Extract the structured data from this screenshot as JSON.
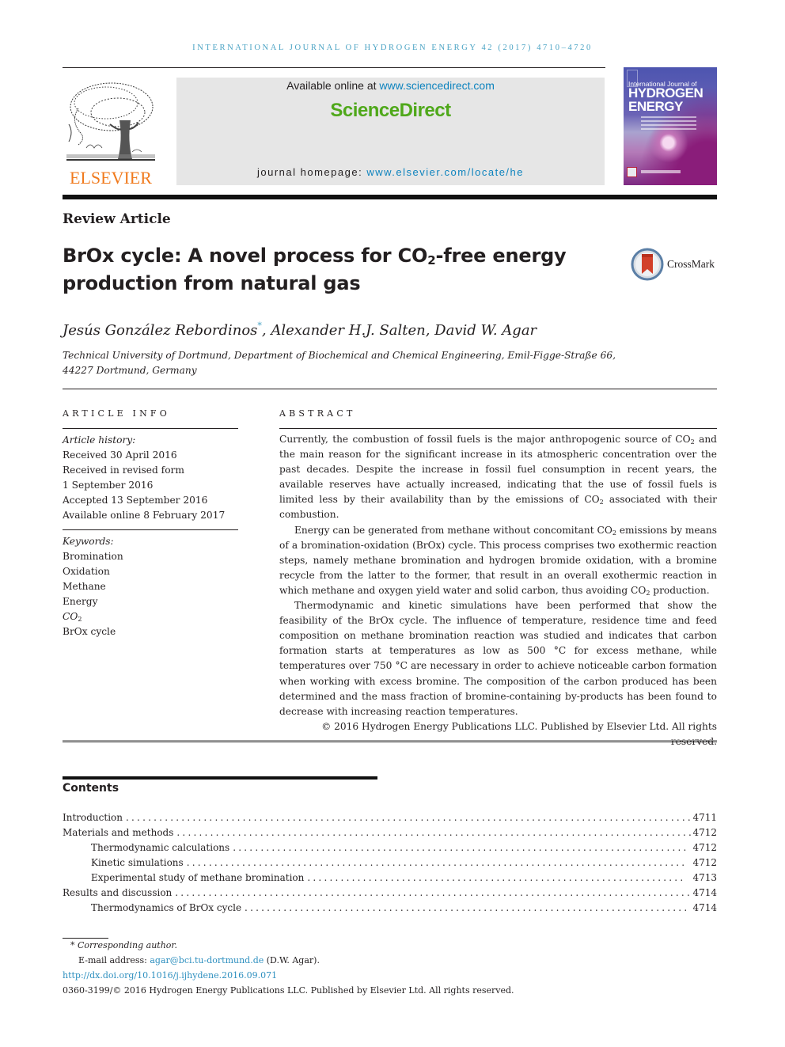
{
  "running_head": "INTERNATIONAL JOURNAL OF HYDROGEN ENERGY 42 (2017) 4710–4720",
  "publisher": {
    "logo_text": "ELSEVIER",
    "available_prefix": "Available online at ",
    "available_link": "www.sciencedirect.com",
    "brand": "ScienceDirect",
    "homepage_prefix": "journal homepage: ",
    "homepage_link": "www.elsevier.com/locate/he"
  },
  "cover": {
    "line1": "International Journal of",
    "line2": "HYDROGEN",
    "line3": "ENERGY"
  },
  "article_type": "Review Article",
  "title": {
    "part1": "BrOx cycle: A novel process for CO",
    "sub": "2",
    "part2": "-free energy production from natural gas"
  },
  "crossmark_label": "CrossMark",
  "authors": {
    "author1": "Jesús González Rebordinos",
    "author1_mark": "*",
    "rest": ", Alexander H.J. Salten, David W. Agar"
  },
  "affiliation": "Technical University of Dortmund, Department of Biochemical and Chemical Engineering, Emil-Figge-Straße 66, 44227 Dortmund, Germany",
  "article_info": {
    "heading": "ARTICLE INFO",
    "history_label": "Article history:",
    "history": [
      "Received 30 April 2016",
      "Received in revised form",
      "1 September 2016",
      "Accepted 13 September 2016",
      "Available online 8 February 2017"
    ],
    "keywords_label": "Keywords:",
    "keywords": [
      "Bromination",
      "Oxidation",
      "Methane",
      "Energy",
      "CO",
      "BrOx cycle"
    ],
    "keyword_co2_sub": "2"
  },
  "abstract": {
    "heading": "ABSTRACT",
    "p1_a": "Currently, the combustion of fossil fuels is the major anthropogenic source of CO",
    "p1_b": " and the main reason for the significant increase in its atmospheric concentration over the past decades. Despite the increase in fossil fuel consumption in recent years, the available reserves have actually increased, indicating that the use of fossil fuels is limited less by their availability than by the emissions of CO",
    "p1_c": " associated with their combustion.",
    "p2_a": "Energy can be generated from methane without concomitant CO",
    "p2_b": " emissions by means of a bromination-oxidation (BrOx) cycle. This process comprises two exothermic reaction steps, namely methane bromination and hydrogen bromide oxidation, with a bromine recycle from the latter to the former, that result in an overall exothermic reaction in which methane and oxygen yield water and solid carbon, thus avoiding CO",
    "p2_c": " production.",
    "p3": "Thermodynamic and kinetic simulations have been performed that show the feasibility of the BrOx cycle. The influence of temperature, residence time and feed composition on methane bromination reaction was studied and indicates that carbon formation starts at temperatures as low as 500 °C for excess methane, while temperatures over 750 °C are necessary in order to achieve noticeable carbon formation when working with excess bromine. The composition of the carbon produced has been determined and the mass fraction of bromine-containing by-products has been found to decrease with increasing reaction temperatures.",
    "sub2": "2",
    "copyright": "© 2016 Hydrogen Energy Publications LLC. Published by Elsevier Ltd. All rights reserved."
  },
  "contents": {
    "heading": "Contents",
    "items": [
      {
        "label": "Introduction",
        "page": "4711",
        "level": 1
      },
      {
        "label": "Materials and methods",
        "page": "4712",
        "level": 1
      },
      {
        "label": "Thermodynamic calculations",
        "page": "4712",
        "level": 2
      },
      {
        "label": "Kinetic simulations",
        "page": "4712",
        "level": 2
      },
      {
        "label": "Experimental study of methane bromination",
        "page": "4713",
        "level": 2
      },
      {
        "label": "Results and discussion",
        "page": "4714",
        "level": 1
      },
      {
        "label": "Thermodynamics of BrOx cycle",
        "page": "4714",
        "level": 2
      }
    ]
  },
  "footnotes": {
    "corresponding_mark": "*",
    "corresponding": "Corresponding author.",
    "email_label": "E-mail address: ",
    "email": "agar@bci.tu-dortmund.de",
    "email_suffix": " (D.W. Agar).",
    "doi": "http://dx.doi.org/10.1016/j.ijhydene.2016.09.071",
    "issn_line": "0360-3199/© 2016 Hydrogen Energy Publications LLC. Published by Elsevier Ltd. All rights reserved."
  },
  "colors": {
    "link_blue": "#0d83be",
    "head_blue": "#4aa3c4",
    "sd_green": "#4fa81a",
    "elsevier_orange": "#f07a1d"
  }
}
